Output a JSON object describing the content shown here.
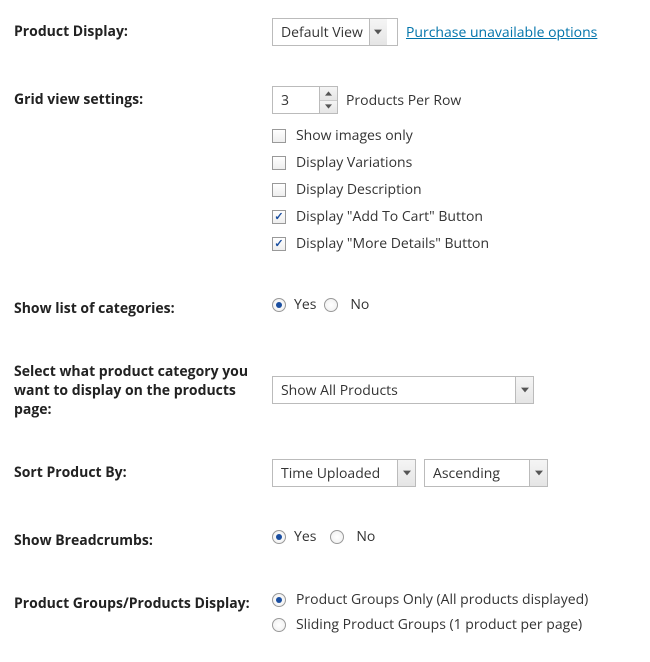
{
  "product_display": {
    "label": "Product Display:",
    "selected": "Default View",
    "link_text": "Purchase unavailable options"
  },
  "grid_view": {
    "label": "Grid view settings:",
    "per_row_value": "3",
    "per_row_suffix": "Products Per Row",
    "options": [
      {
        "label": "Show images only",
        "checked": false
      },
      {
        "label": "Display Variations",
        "checked": false
      },
      {
        "label": "Display Description",
        "checked": false
      },
      {
        "label": "Display \"Add To Cart\" Button",
        "checked": true
      },
      {
        "label": "Display \"More Details\" Button",
        "checked": true
      }
    ]
  },
  "show_categories": {
    "label": "Show list of categories:",
    "yes": "Yes",
    "no": "No"
  },
  "category_select": {
    "label": "Select what product category you want to display on the products page:",
    "selected": "Show All Products"
  },
  "sort_by": {
    "label": "Sort Product By:",
    "field": "Time Uploaded",
    "order": "Ascending"
  },
  "breadcrumbs": {
    "label": "Show Breadcrumbs:",
    "yes": "Yes",
    "no": "No"
  },
  "groups": {
    "label": "Product Groups/Products Display:",
    "opt1": "Product Groups Only (All products displayed)",
    "opt2": "Sliding Product Groups (1 product per page)"
  }
}
